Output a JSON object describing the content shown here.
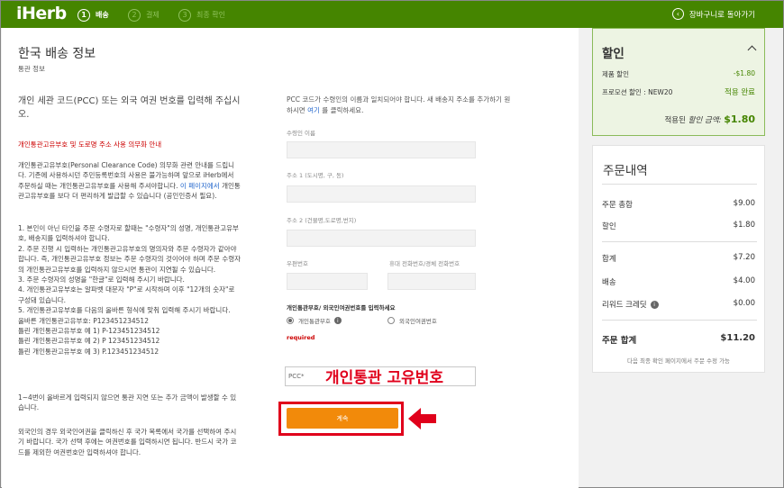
{
  "header": {
    "logo": "iHerb",
    "steps": [
      {
        "num": "1",
        "label": "배송"
      },
      {
        "num": "2",
        "label": "결제"
      },
      {
        "num": "3",
        "label": "최종 확인"
      }
    ],
    "back_label": "장바구니로 돌아가기"
  },
  "main": {
    "title": "한국 배송 정보",
    "subtitle": "통관 정보",
    "intro": "개인 세관 코드(PCC) 또는 외국 여권 번호를 입력해 주십시오.",
    "red_heading": "개인통관고유부호 및 도로명 주소 사용 의무화 안내",
    "paragraph1_a": "개인통관고유부호(Personal Clearance Code) 의무화 관련 안내를 드립니다. 기존에 사용하시던 주민등록번호의 사용은 불가능하며 앞으로 iHerb에서 주문하실 때는 개인통관고유부호를 사용해 주셔야합니다. ",
    "paragraph1_link": "이 페이지에서",
    "paragraph1_b": " 개인통관고유부호를 보다 더 편리하게 발급할 수 있습니다 (공인인증서 필요).",
    "rules": [
      "1. 본인이 아닌 타인을 주문 수령자로 할때는 \"수령자\"의 성명, 개인통관고유부호, 배송지를 입력하셔야 합니다.",
      "2. 주문 진행 시 입력하는 개인통관고유부호의 명의자와 주문 수령자가 같아야 합니다. 즉, 개인통관고유부호 정보는 주문 수령자의 것이어야 하며 주문 수령자의 개인통관고유부호를 입력하지 않으시면 통관이 지연될 수 있습니다.",
      "3. 주문 수령자의 성명을 \"한글\"로 입력해 주시기 바랍니다.",
      "4. 개인통관고유부호는 알파벳 대문자 \"P\"로 시작하며 이후 \"12개의 숫자\"로 구성돼 있습니다.",
      "5. 개인통관고유부호를 다음의 올바른 형식에 맞춰 입력해 주시기 바랍니다.",
      "올바른 개인통관고유부호: P123451234512",
      "틀린 개인통관고유부호 예 1) P-123451234512",
      "틀린 개인통관고유부호 예 2) P 123451234512",
      "틀린 개인통관고유부호 예 3) P.123451234512"
    ],
    "warning": "1~4번이 올바르게 입력되지 않으면 통관 지연 또는 추가 금액이 발생할 수 있습니다.",
    "foreign": "외국인의 경우 외국인여권을 클릭하신 후 국가 목록에서 국가를 선택하여 주시기 바랍니다. 국가 선택 후에는 여권번호를 입력하시면 됩니다. 반드시 국가 코드를 제외한 여권번호만 입력하셔야 합니다."
  },
  "form": {
    "intro_a": "PCC 코드가 수령인의 이름과 일치되어야 합니다. 새 배송지 주소를 추가하기 원하시면 ",
    "intro_link": "여기",
    "intro_b": " 를 클릭하세요.",
    "recipient_label": "수령인 이름",
    "addr1_label": "주소 1 (도시명, 구, 동)",
    "addr2_label": "주소 2 (건물명,도로명,번지)",
    "zip_label": "우편번호",
    "phone_label": "휴대 전화번호/경체 전화번호",
    "pcc_heading": "개인통관부호/ 외국인여권번호를 입력하세요",
    "radio_pcc": "개인통관부호",
    "radio_passport": "외국인여권번호",
    "required": "required",
    "pcc_placeholder": "PCC*",
    "overlay": "개인통관 고유번호",
    "continue": "계속"
  },
  "discount": {
    "title": "할인",
    "product_label": "제품 할인",
    "product_value": "-$1.80",
    "promo_label": "프로모션 할인 : NEW20",
    "promo_status": "적용 완료",
    "applied_label": "적용된 ",
    "applied_em": "할인 금액:",
    "applied_value": "$1.80"
  },
  "summary": {
    "title": "주문내역",
    "order_total_label": "주문 총합",
    "order_total_value": "$9.00",
    "discount_label": "할인",
    "discount_value": "$1.80",
    "subtotal_label": "합계",
    "subtotal_value": "$7.20",
    "shipping_label": "배송",
    "shipping_value": "$4.00",
    "reward_label": "리워드 크레딧",
    "reward_value": "$0.00",
    "total_label": "주문 합계",
    "total_value": "$11.20",
    "note": "다음 최종 확인 페이지에서 주문 수정 가능"
  },
  "colors": {
    "brand": "#458500",
    "accent": "#f28a0a",
    "alert": "#e0001b"
  }
}
